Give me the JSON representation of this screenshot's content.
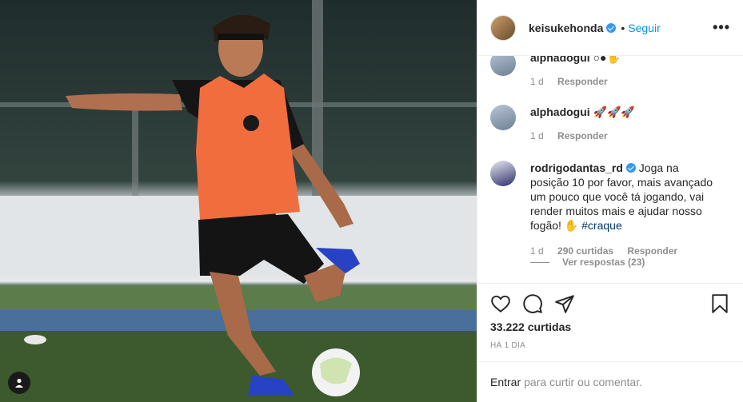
{
  "post": {
    "username": "keisukehonda",
    "dot": "•",
    "follow_label": "Seguir",
    "more_label": "•••"
  },
  "comments": [
    {
      "username": "alphadogui",
      "text": "○●✋",
      "time": "1 d",
      "likes": "",
      "reply_label": "Responder"
    },
    {
      "username": "alphadogui",
      "text": "🚀🚀🚀",
      "time": "1 d",
      "likes": "",
      "reply_label": "Responder"
    },
    {
      "username": "rodrigodantas_rd",
      "text": "Joga na posição 10 por favor, mais avançado um pouco que você tá jogando, vai render muitos mais e ajudar nosso fogão! ✋",
      "hashtag": "#craque",
      "time": "1 d",
      "likes": "290 curtidas",
      "reply_label": "Responder"
    }
  ],
  "view_replies_label": "Ver respostas (23)",
  "likes_count": "33.222 curtidas",
  "posted_time": "HÁ 1 DIA",
  "add_comment": {
    "enter_label": "Entrar",
    "rest_label": "para curtir ou comentar."
  },
  "icons": {
    "like": "heart-icon",
    "comment": "comment-icon",
    "share": "send-icon",
    "save": "bookmark-icon",
    "photo_tag": "user-tag-icon"
  },
  "colors": {
    "link": "#0095f6",
    "verified": "#3897f0",
    "muted": "#8e8e8e",
    "vest": "#f26d3d"
  }
}
